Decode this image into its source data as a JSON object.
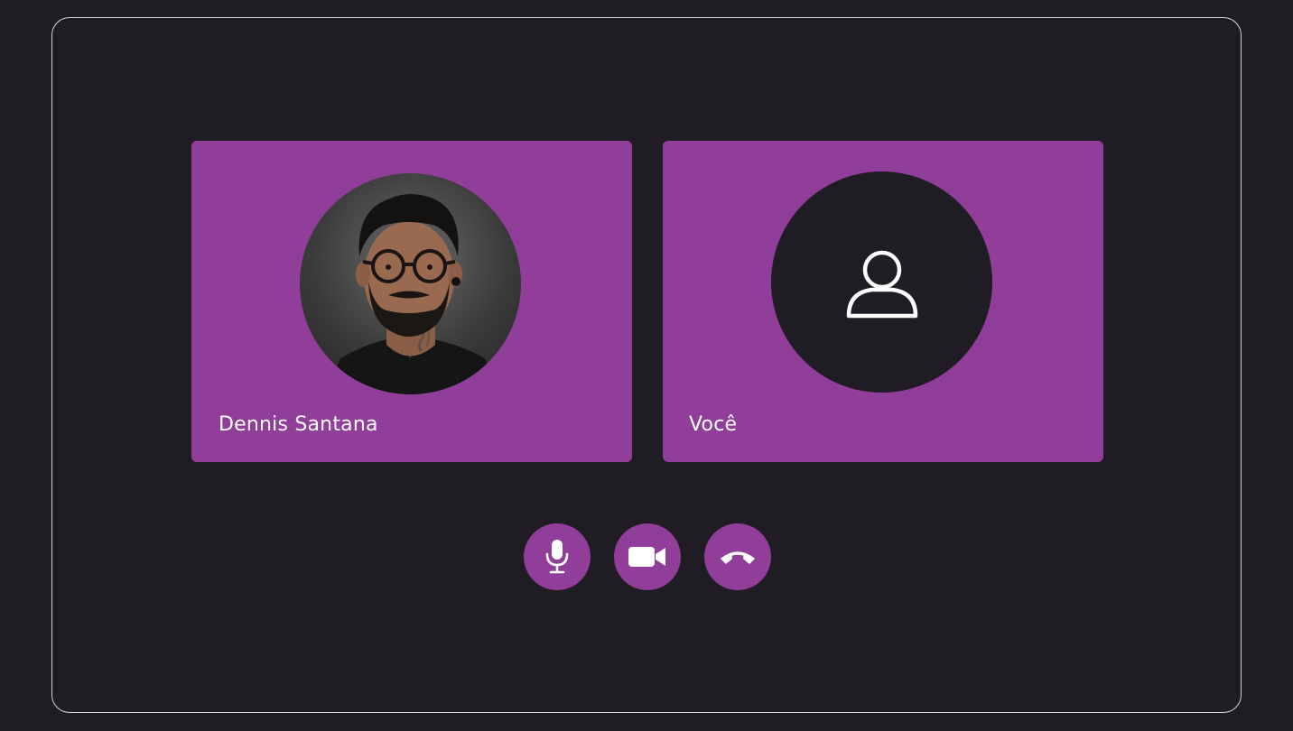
{
  "call": {
    "participants": [
      {
        "name": "Dennis Santana",
        "avatar": "photo"
      },
      {
        "name": "Você",
        "avatar": "user-icon"
      }
    ],
    "controls": [
      {
        "icon": "microphone-icon"
      },
      {
        "icon": "video-camera-icon"
      },
      {
        "icon": "hang-up-icon"
      }
    ]
  },
  "colors": {
    "background": "#201c23",
    "tile": "#913d9a",
    "frame_border": "#d9d4dc",
    "text": "#ffffff"
  }
}
